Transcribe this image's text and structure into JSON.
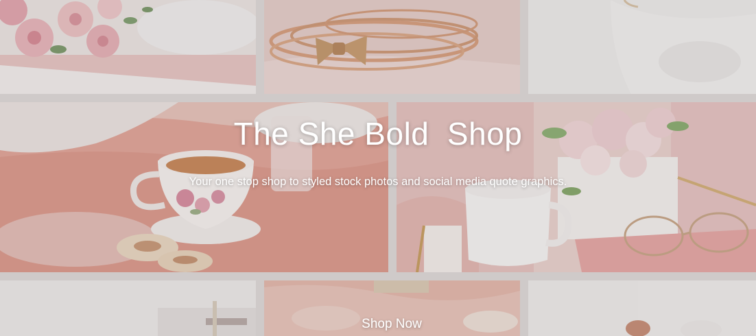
{
  "hero": {
    "title": "The She Bold  Shop",
    "subtitle": "Your one stop shop to styled stock photos and social media quote graphics.",
    "cta_label": "Shop Now"
  },
  "tiles": [
    {
      "name": "photo-tile-roses",
      "subject": "pink-roses-bouquet"
    },
    {
      "name": "photo-tile-bracelets",
      "subject": "gold-bangle-bracelets"
    },
    {
      "name": "photo-tile-white-fabric",
      "subject": "white-fabric"
    },
    {
      "name": "photo-tile-tea-cup",
      "subject": "tea-cup-and-cookies"
    },
    {
      "name": "photo-tile-flowers-mug",
      "subject": "flowers-mug-sunglasses"
    },
    {
      "name": "photo-tile-white-desk",
      "subject": "white-desk"
    },
    {
      "name": "photo-tile-pink-fluffy",
      "subject": "pink-fluffy-texture"
    },
    {
      "name": "photo-tile-white-room",
      "subject": "white-room"
    }
  ],
  "colors": {
    "background": "#dfdbda",
    "text": "#ffffff",
    "blush": "#e8b1a7",
    "cream": "#f2e8e4"
  }
}
